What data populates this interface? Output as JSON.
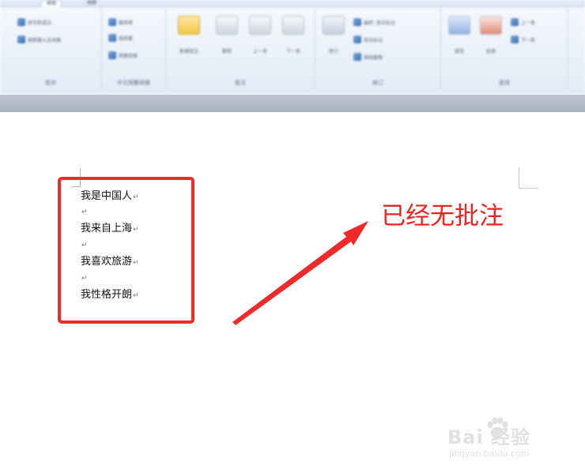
{
  "ribbon": {
    "tabs": [
      "审阅",
      "视图"
    ],
    "groups": {
      "proofing": {
        "label": "校对",
        "buttons": [
          "拼写和语法",
          "更新输入法词典"
        ]
      },
      "chinese": {
        "label": "中文简繁转换",
        "buttons": [
          "繁转简",
          "简转繁",
          "简繁转换"
        ]
      },
      "comments": {
        "label": "批注",
        "new_comment": "新建批注",
        "delete": "删除",
        "previous": "上一条",
        "next": "下一条"
      },
      "tracking": {
        "label": "修订",
        "track_changes": "修订",
        "display": "最终: 显示标记",
        "show_markup": "显示标记",
        "review_pane": "审阅窗格"
      },
      "changes": {
        "label": "更改",
        "accept": "接受",
        "reject": "拒绝",
        "previous": "上一条",
        "next": "下一条"
      }
    }
  },
  "document": {
    "lines": [
      "我是中国人",
      "我来自上海",
      "我喜欢旅游",
      "我性格开朗"
    ],
    "paragraph_mark": "↵"
  },
  "annotation": {
    "text": "已经无批注",
    "color": "#ee2222"
  },
  "watermark": {
    "brand": "Bai  经验",
    "url": "jingyan.baidu.com"
  }
}
